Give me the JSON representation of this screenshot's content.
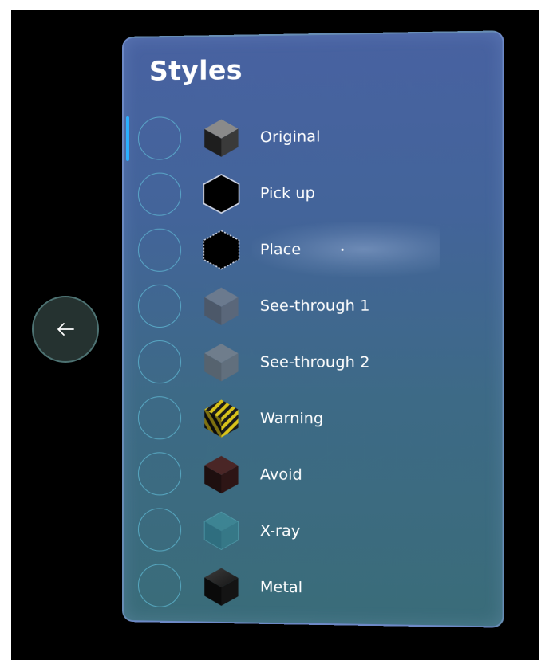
{
  "panel": {
    "title": "Styles",
    "selected_index": 0,
    "items": [
      {
        "label": "Original",
        "icon": "original-cube-icon"
      },
      {
        "label": "Pick up",
        "icon": "pick-up-cube-icon"
      },
      {
        "label": "Place",
        "icon": "place-cube-icon"
      },
      {
        "label": "See-through 1",
        "icon": "see-through-1-cube-icon"
      },
      {
        "label": "See-through 2",
        "icon": "see-through-2-cube-icon"
      },
      {
        "label": "Warning",
        "icon": "warning-cube-icon"
      },
      {
        "label": "Avoid",
        "icon": "avoid-cube-icon"
      },
      {
        "label": "X-ray",
        "icon": "x-ray-cube-icon"
      },
      {
        "label": "Metal",
        "icon": "metal-cube-icon"
      }
    ]
  },
  "back_button": {
    "icon": "arrow-left-icon"
  },
  "colors": {
    "panel_top": "#4862a1",
    "panel_bottom": "#3a6c79",
    "selection_indicator": "#2ab0ff",
    "radio_ring": "#62bcd7",
    "back_button_fill": "#253230",
    "back_button_ring": "#4d7272"
  }
}
